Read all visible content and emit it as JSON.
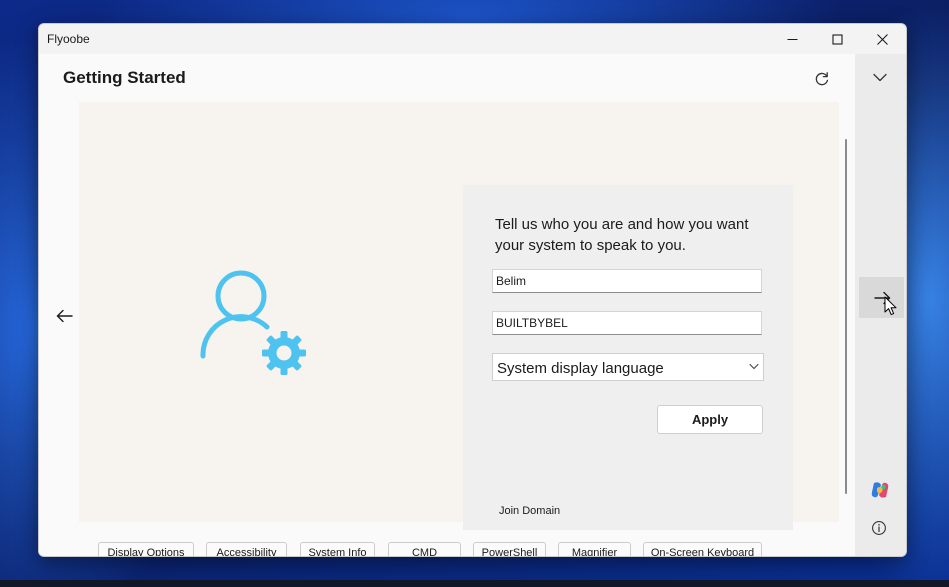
{
  "window": {
    "title": "Flyoobe"
  },
  "page": {
    "title": "Getting Started"
  },
  "card": {
    "heading": "Tell us who you are and how you want your system to speak to you.",
    "username": {
      "value": "Belim"
    },
    "computer_name": {
      "value": "BUILTBYBEL"
    },
    "language": {
      "selected": "System display language"
    },
    "apply_label": "Apply",
    "join_domain_label": "Join Domain"
  },
  "quick_actions": [
    {
      "label": "Display Options"
    },
    {
      "label": "Accessibility"
    },
    {
      "label": "System Info"
    },
    {
      "label": "CMD"
    },
    {
      "label": "PowerShell"
    },
    {
      "label": "Magnifier"
    },
    {
      "label": "On-Screen Keyboard"
    }
  ],
  "icons": {
    "hero": "user-settings-icon",
    "refresh": "refresh-icon",
    "back": "arrow-left-icon",
    "next": "arrow-right-icon",
    "side_toggle": "chevron-down-icon",
    "assistant": "copilot-icon",
    "info": "info-icon"
  },
  "colors": {
    "accent": "#4fc3f0",
    "stage_background": "#f7f3ef",
    "card_background": "#efefef"
  }
}
